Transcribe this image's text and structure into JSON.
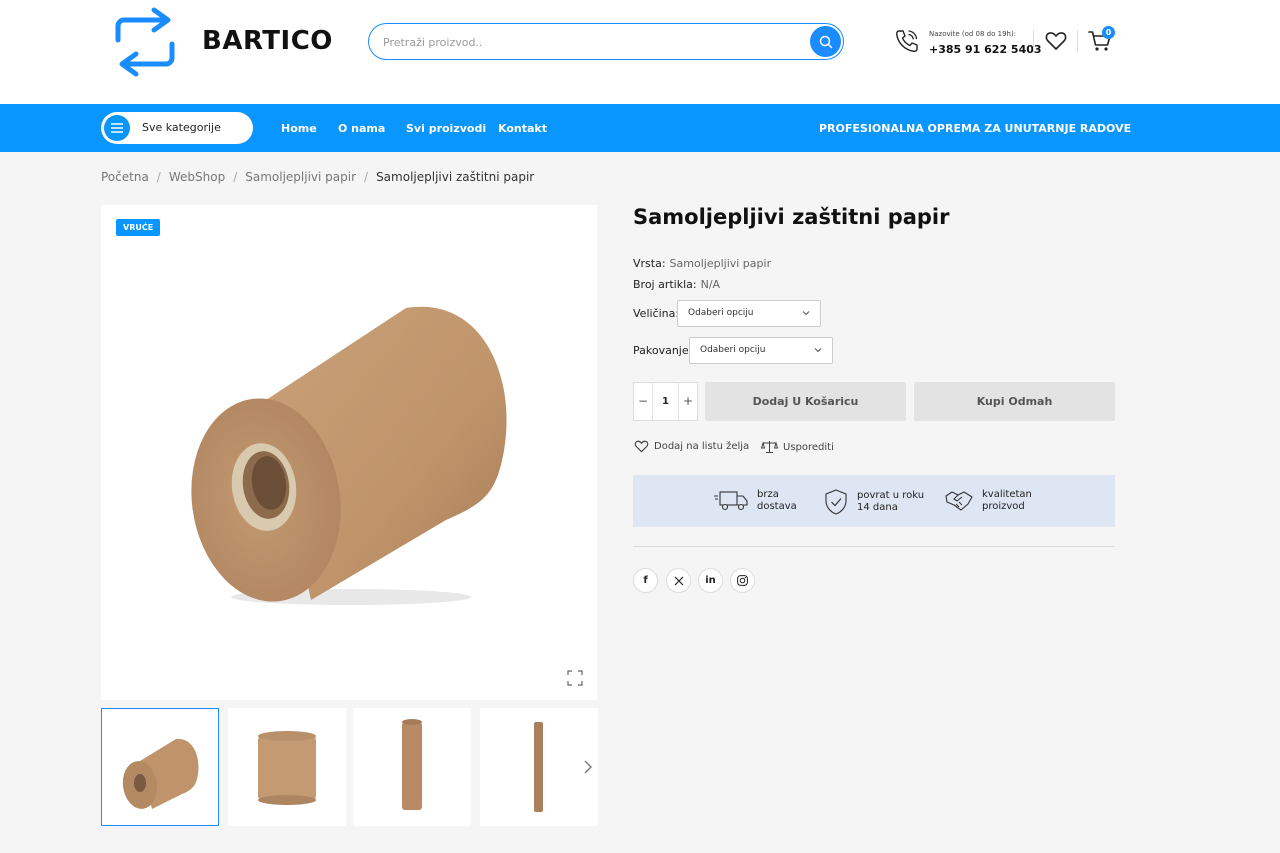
{
  "header": {
    "brand": "BARTICO",
    "search_placeholder": "Pretraži proizvod..",
    "call_label": "Nazovite (od 08 do 19h):",
    "call_number": "+385 91 622 5403",
    "cart_count": "0"
  },
  "nav": {
    "categories_label": "Sve kategorije",
    "links": [
      "Home",
      "O nama",
      "Svi proizvodi",
      "Kontakt"
    ],
    "promo": "PROFESIONALNA OPREMA ZA UNUTARNJE RADOVE"
  },
  "breadcrumb": [
    "Početna",
    "WebShop",
    "Samoljepljivi papir",
    "Samoljepljivi zaštitni papir"
  ],
  "gallery": {
    "badge": "VRUĆE"
  },
  "product": {
    "title": "Samoljepljivi zaštitni papir",
    "type_label": "Vrsta:",
    "type_value": "Samoljepljivi papir",
    "sku_label": "Broj artikla:",
    "sku_value": "N/A",
    "size_label": "Veličina:",
    "size_value": "Odaberi opciju",
    "pack_label": "Pakovanje:",
    "pack_value": "Odaberi opciju",
    "quantity": "1",
    "add_to_cart": "Dodaj U Košaricu",
    "buy_now": "Kupi Odmah",
    "wishlist": "Dodaj na listu želja",
    "compare": "Usporediti"
  },
  "features": [
    {
      "line1": "brza",
      "line2": "dostava",
      "icon": "truck-icon"
    },
    {
      "line1": "povrat u roku",
      "line2": "14 dana",
      "icon": "shield-check-icon"
    },
    {
      "line1": "kvalitetan",
      "line2": "proizvod",
      "icon": "handshake-icon"
    }
  ],
  "social": [
    "facebook-icon",
    "x-icon",
    "linkedin-icon",
    "instagram-icon"
  ],
  "colors": {
    "accent": "#0a96ff",
    "feature_bg": "#dfe6f3",
    "paper": "#c49a73"
  }
}
